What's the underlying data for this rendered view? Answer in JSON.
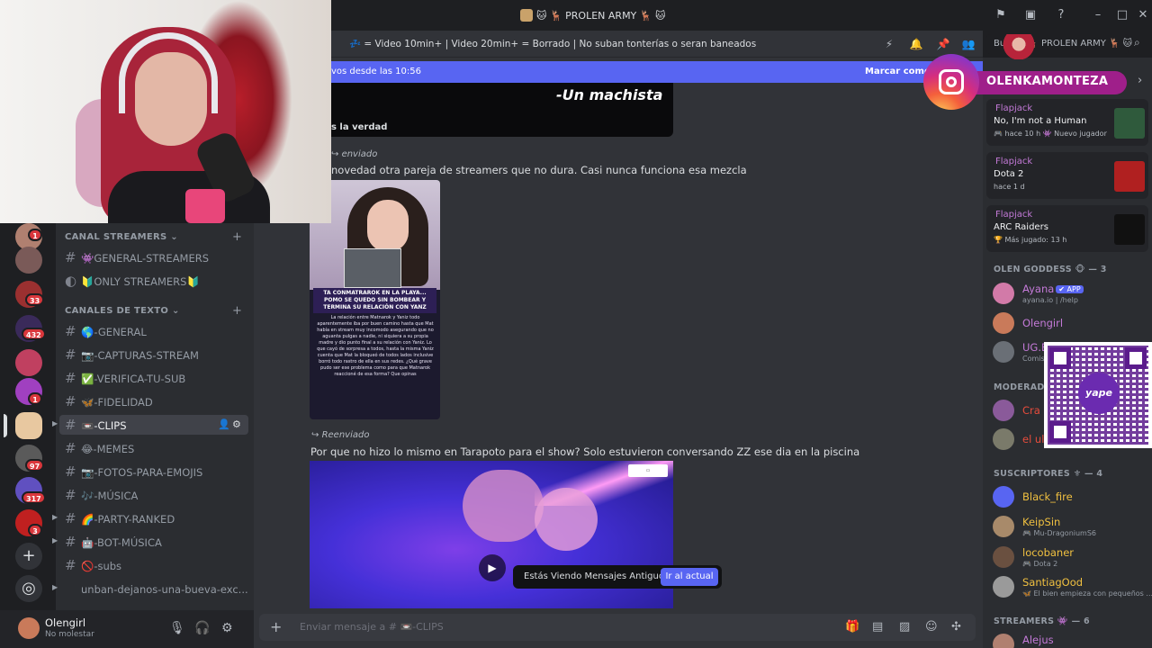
{
  "window": {
    "title": "🐱 🦌 PROLEN ARMY 🦌 🐱"
  },
  "header": {
    "channel_topic": "💤 = Video 10min+ | Video 20min+ = Borrado | No suban tonterías o seran baneados",
    "search_placeholder": "Buscar 🦌 PROLEN ARMY 🦌 🐱"
  },
  "new_messages_bar": {
    "text": "vos desde las 10:56",
    "mark_label": "Marcar como leído"
  },
  "rail": {
    "badges": [
      "1",
      "33",
      "432",
      "1",
      "97",
      "317",
      "3"
    ]
  },
  "channels": {
    "categories": [
      {
        "name": "CANAL STREAMERS ⌄",
        "plus": "+"
      },
      {
        "name": "CANALES DE TEXTO ⌄",
        "plus": "+"
      }
    ],
    "items": [
      {
        "label": "👾GENERAL-STREAMERS",
        "color": "#7b68ee"
      },
      {
        "label": "🔰ONLY STREAMERS🔰",
        "color": "#e0c030"
      },
      {
        "label": "🌎-GENERAL",
        "color": "#3ba55d"
      },
      {
        "label": "📷-CAPTURAS-STREAM",
        "color": "#b5bac1"
      },
      {
        "label": "✅-VERIFICA-TU-SUB",
        "color": "#3ba55d"
      },
      {
        "label": "🦋-FIDELIDAD",
        "color": "#e67e22"
      },
      {
        "label": "📼-CLIPS",
        "color": "#b5bac1"
      },
      {
        "label": "😂-MEMES",
        "color": "#f0b232"
      },
      {
        "label": "📷-FOTOS-PARA-EMOJIS",
        "color": "#b5bac1"
      },
      {
        "label": "🎶-MÚSICA",
        "color": "#7b68ee"
      },
      {
        "label": "🌈-PARTY-RANKED",
        "color": "#e74c3c"
      },
      {
        "label": "🤖-BOT-MÚSICA",
        "color": "#b5bac1"
      },
      {
        "label": "🚫-subs",
        "color": "#da373c"
      },
      {
        "label": "unban-dejanos-una-bueva-exc...",
        "color": ""
      }
    ]
  },
  "user": {
    "name": "Olengirl",
    "status": "No molestar"
  },
  "messages": {
    "quote": "-Un machista",
    "quote_caption": "s la verdad",
    "forwarded_1": "enviado",
    "text_1": "novedad otra pareja de streamers que no dura. Casi nunca funciona esa mezcla",
    "tiktok_headline": "TA CONMATRAROK EN LA PLAYA... POMO SE QUEDO SIN BOMBEAR Y TERMINA SU RELACIÓN CON YANZ",
    "tiktok_body": "La relación entre Matnarok y Yaniz todo aparentemente iba por buen camino hasta que Mat había en stream muy incomodo asegurando que no aguanta pulgas a nadie, ni siquiera a su propia madre y dio punto final a su relación con Yaniz. Lo que cayó de sorpresa a todos, hasta la misma Yaniz cuenta que Mat la bloqueó de todos lados inclusive borró todo rastro de ella en sus redes. ¿Qué grave pudo ser ese problema como para que Matnarok reaccioné de esa forma? Que opinas",
    "forwarded_2": "Reenviado",
    "text_2": "Por que no hizo lo mismo en Tarapoto para el show? Solo estuvieron conversando ZZ ese dia en la piscina"
  },
  "old_messages": {
    "text": "Estás Viendo Mensajes Antiguos",
    "button": "Ir al actual"
  },
  "composer": {
    "placeholder": "Enviar mensaje a # 📼-CLIPS"
  },
  "instagram": {
    "handle": "OLENKAMONTEZA"
  },
  "activities": [
    {
      "name": "Flapjack",
      "title": "No, I'm not a Human",
      "meta": "🎮 hace 10 h  👾 Nuevo jugador",
      "art_color": "#2f5a3c"
    },
    {
      "name": "Flapjack",
      "title": "Dota 2",
      "meta": "hace 1 d",
      "art_color": "#b02020"
    },
    {
      "name": "Flapjack",
      "title": "ARC Raiders",
      "meta": "🏆 Más jugado: 13 h",
      "art_color": "#111111"
    }
  ],
  "member_sections": [
    {
      "title": "OLEN GODDESS 🐵 — 3"
    },
    {
      "title": "MODERADO"
    },
    {
      "title": "SUSCRIPTORES ⚜ — 4"
    },
    {
      "title": "STREAMERS 👾 — 6"
    }
  ],
  "members": [
    {
      "name": "Ayana",
      "tag": "✔ APP",
      "sub": "ayana.io | /help",
      "color": "#c47ad8",
      "avatar": "#d27aa8"
    },
    {
      "name": "Olengirl",
      "tag": "",
      "sub": "",
      "color": "#c47ad8",
      "avatar": "#c97a5a"
    },
    {
      "name": "UG.B",
      "tag": "",
      "sub": "Comis",
      "color": "#c47ad8",
      "avatar": "#6a6f76"
    },
    {
      "name": "Cra",
      "tag": "",
      "sub": "",
      "color": "#e74c3c",
      "avatar": "#8a5a9a"
    },
    {
      "name": "el ul",
      "tag": "",
      "sub": "",
      "color": "#e74c3c",
      "avatar": "#7a7a6a"
    },
    {
      "name": "Black_fire",
      "tag": "",
      "sub": "",
      "color": "#f0c040",
      "avatar": "#5865f2"
    },
    {
      "name": "KeipSin",
      "tag": "",
      "sub": "🎮 Mu-DragoniumS6",
      "color": "#f0c040",
      "avatar": "#a88a6a"
    },
    {
      "name": "locobaner",
      "tag": "",
      "sub": "🎮 Dota 2",
      "color": "#f0c040",
      "avatar": "#6a5040"
    },
    {
      "name": "SantiagOod",
      "tag": "",
      "sub": "🦋 El bien empieza con pequeños ...",
      "color": "#f0c040",
      "avatar": "#9a9a9a"
    },
    {
      "name": "Alejus",
      "tag": "",
      "sub": "",
      "color": "#c47ad8",
      "avatar": "#b08070"
    }
  ],
  "qr": {
    "brand": "yape"
  }
}
